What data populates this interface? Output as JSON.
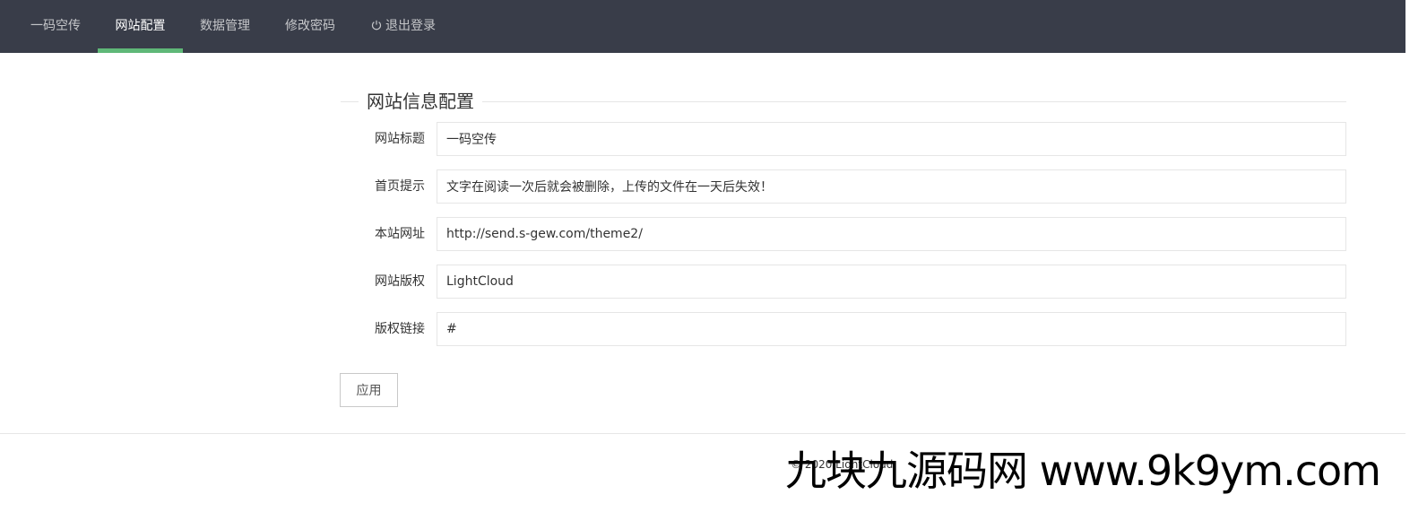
{
  "nav": {
    "items": [
      {
        "label": "一码空传",
        "active": false
      },
      {
        "label": "网站配置",
        "active": true
      },
      {
        "label": "数据管理",
        "active": false
      },
      {
        "label": "修改密码",
        "active": false
      },
      {
        "label": "退出登录",
        "active": false,
        "icon": "power-icon"
      }
    ]
  },
  "form": {
    "legend": "网站信息配置",
    "fields": [
      {
        "label": "网站标题",
        "value": "一码空传"
      },
      {
        "label": "首页提示",
        "value": "文字在阅读一次后就会被删除，上传的文件在一天后失效！"
      },
      {
        "label": "本站网址",
        "value": "http://send.s-gew.com/theme2/"
      },
      {
        "label": "网站版权",
        "value": "LightCloud"
      },
      {
        "label": "版权链接",
        "value": "#"
      }
    ],
    "apply_label": "应用"
  },
  "footer": {
    "text": "© 2020 LightCloud"
  },
  "watermark": {
    "text": "九块九源码网 www.9k9ym.com"
  },
  "colors": {
    "nav_bg": "#393d49",
    "nav_active_bar": "#5fb878",
    "border": "#e6e6e6"
  }
}
